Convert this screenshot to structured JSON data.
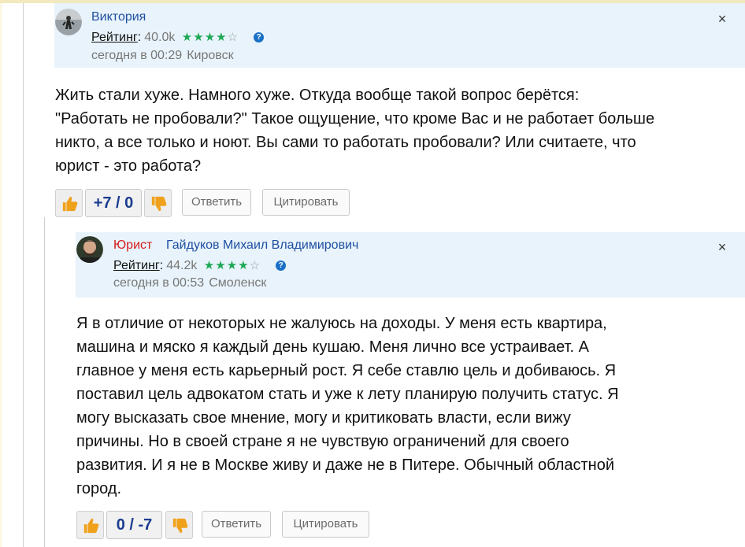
{
  "comments": [
    {
      "author": "Виктория",
      "role": "",
      "rating_label": "Рейтинг",
      "rating_value": "40.0k",
      "stars_filled": 4,
      "stars_total": 5,
      "time": "сегодня в 00:29",
      "city": "Кировск",
      "close_icon": "×",
      "text": "Жить стали хуже. Намного хуже. Откуда вообще такой вопрос берётся:\n\"Работать не пробовали?\" Такое ощущение, что кроме Вас и не работает больше\nникто, а все только и ноют. Вы сами то работать пробовали? Или считаете, что\nюрист - это работа?",
      "score": "+7 / 0",
      "reply_label": "Ответить",
      "quote_label": "Цитировать"
    },
    {
      "author": "Гайдуков Михаил Владимирович",
      "role": "Юрист",
      "rating_label": "Рейтинг",
      "rating_value": "44.2k",
      "stars_filled": 4,
      "stars_total": 5,
      "time": "сегодня в 00:53",
      "city": "Смоленск",
      "close_icon": "×",
      "text": "Я в отличие от некоторых не жалуюсь на доходы. У меня есть квартира,\nмашина и мяско я каждый день кушаю. Меня лично все устраивает. А\nглавное у меня есть карьерный рост. Я себе ставлю цель и добиваюсь. Я\nпоставил цель адвокатом стать и уже к лету планирую получить статус. Я\nмогу высказать свое мнение, могу и критиковать власти, если вижу\nпричины. Но в своей стране я не чувствую ограничений для своего\nразвития. И я не в Москве живу и даже не в Питере. Обычный областной\nгород.",
      "score": "0 / -7",
      "reply_label": "Ответить",
      "quote_label": "Цитировать"
    }
  ],
  "icons": {
    "thumb_up": "thumbs-up-icon",
    "thumb_down": "thumbs-down-icon",
    "help": "help-icon",
    "close": "close-icon"
  },
  "help_glyph": "?",
  "colors": {
    "header_bg": "#e8f3fb",
    "author_link": "#1f4fa0",
    "role_red": "#d51d1d",
    "star_green": "#1da854",
    "thumb_orange": "#f0a11c",
    "score_blue": "#1b3d8f"
  }
}
